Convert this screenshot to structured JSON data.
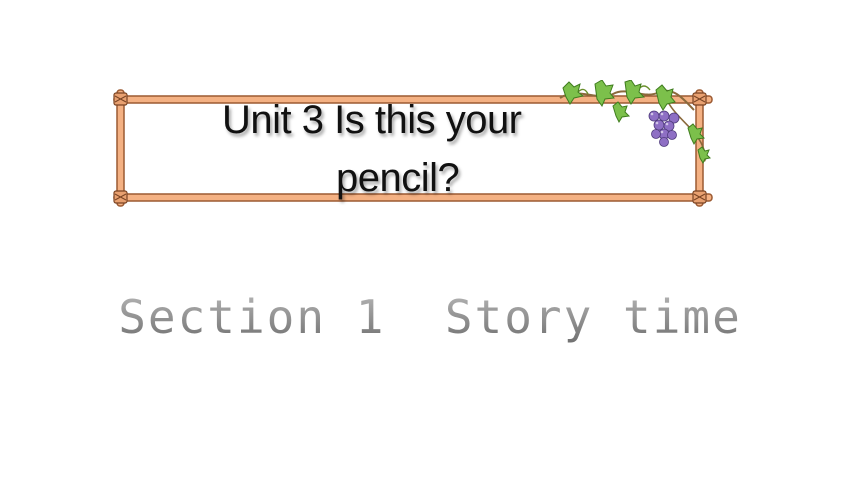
{
  "slide": {
    "title_line1": "Unit 3  Is this your",
    "title_line2": "pencil?",
    "subtitle": "Section 1  Story time"
  },
  "decor": {
    "frame_icon": "wooden-frame-icon",
    "vine_icon": "grape-vine-icon"
  },
  "colors": {
    "frame_fill": "#f4b183",
    "frame_outline": "#9c5a32",
    "leaf": "#7cc04b",
    "grape": "#8e6fc4",
    "subtitle_gray": "#8a8a8a"
  }
}
